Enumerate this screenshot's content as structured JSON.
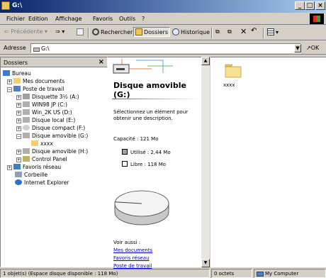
{
  "window": {
    "title": "G:\\"
  },
  "menu": [
    "Fichier",
    "Edition",
    "Affichage",
    "Favoris",
    "Outils",
    "?"
  ],
  "toolbar": {
    "back": "Précédente",
    "search": "Rechercher",
    "folders": "Dossiers",
    "history": "Historique"
  },
  "address": {
    "label": "Adresse",
    "value": "G:\\",
    "go": "OK"
  },
  "folders_pane": {
    "header": "Dossiers",
    "items": [
      "Bureau",
      "Mes documents",
      "Poste de travail",
      "Disquette 3½ (A:)",
      "WIN98 JP (C:)",
      "Win_2K US (D:)",
      "Disque local (E:)",
      "Disque compact (F:)",
      "Disque amovible (G:)",
      "xxxx",
      "Disque amovible (H:)",
      "Control Panel",
      "Favoris réseau",
      "Corbeille",
      "Internet Explorer"
    ]
  },
  "webview": {
    "title_line1": "Disque amovible",
    "title_line2": "(G:)",
    "description": "Sélectionnez un élément pour obtenir une description.",
    "capacity": "Capacité : 121 Mo",
    "used": "Utilisé :  2,44 Mo",
    "free": "Libre :  118 Mo",
    "used_fraction": 0.02,
    "see_also": "Voir aussi :",
    "links": [
      "Mes documents",
      "Favoris réseau",
      "Poste de travail"
    ]
  },
  "files": [
    {
      "name": "xxxx"
    }
  ],
  "status": {
    "objects": "1 objet(s) (Espace disque disponible : 118 Mo)",
    "size": "0 octets",
    "zone": "My Computer"
  },
  "colors": {
    "title_start": "#0a246a",
    "title_end": "#a6caf0",
    "selection": "#0a246a",
    "link": "#0000cc"
  }
}
